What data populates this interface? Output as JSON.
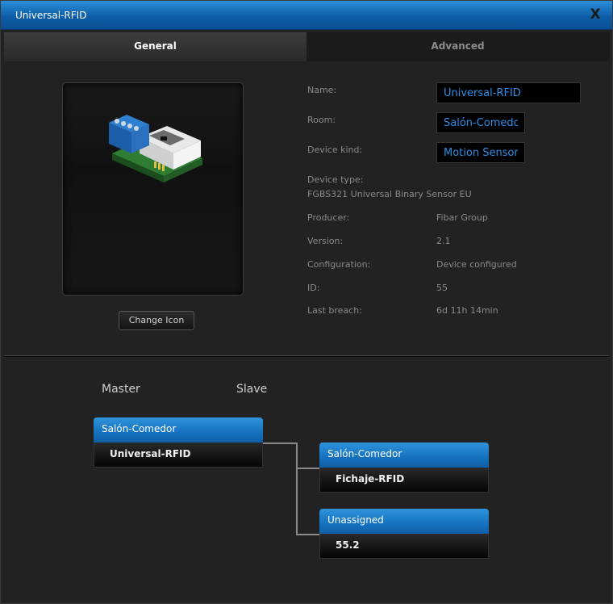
{
  "window": {
    "title": "Universal-RFID",
    "close_label": "X"
  },
  "tabs": {
    "general": "General",
    "advanced": "Advanced"
  },
  "device_icon": {
    "change_button": "Change Icon"
  },
  "fields": {
    "name_label": "Name:",
    "name_value": "Universal-RFID",
    "room_label": "Room:",
    "room_value": "Salón-Comedor",
    "kind_label": "Device kind:",
    "kind_value": "Motion Sensor",
    "type_label": "Device type:",
    "type_value": "FGBS321 Universal Binary Sensor EU",
    "producer_label": "Producer:",
    "producer_value": "Fibar Group",
    "version_label": "Version:",
    "version_value": "2.1",
    "config_label": "Configuration:",
    "config_value": "Device configured",
    "id_label": "ID:",
    "id_value": "55",
    "breach_label": "Last breach:",
    "breach_value": "6d 11h 14min"
  },
  "association": {
    "master_heading": "Master",
    "slave_heading": "Slave",
    "master": {
      "room": "Salón-Comedor",
      "name": "Universal-RFID"
    },
    "slaves": [
      {
        "room": "Salón-Comedor",
        "name": "Fichaje-RFID"
      },
      {
        "room": "Unassigned",
        "name": "55.2"
      }
    ]
  },
  "colors": {
    "accent": "#1a78c8",
    "input_text": "#2d8fe6"
  }
}
